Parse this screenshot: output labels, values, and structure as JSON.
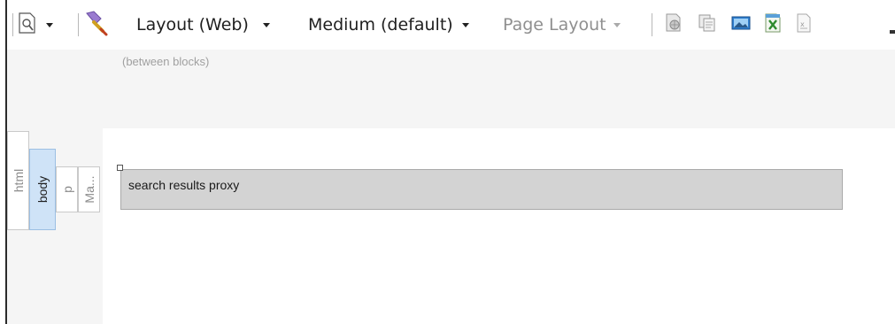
{
  "toolbar": {
    "layout_label": "Layout (Web)",
    "size_label": "Medium (default)",
    "page_layout_label": "Page Layout",
    "icons": [
      "page-preview-icon",
      "style-brush-icon",
      "web-page-icon",
      "copy-page-icon",
      "image-icon",
      "excel-export-icon",
      "excel-file-icon"
    ]
  },
  "hint": "(between blocks)",
  "breadcrumb": {
    "items": [
      {
        "label": "html"
      },
      {
        "label": "body"
      },
      {
        "label": "p"
      },
      {
        "label": "Ma..."
      }
    ]
  },
  "block": {
    "label": "search results proxy"
  },
  "colors": {
    "active_tab": "#cfe3f7",
    "block_fill": "#d3d3d3"
  }
}
